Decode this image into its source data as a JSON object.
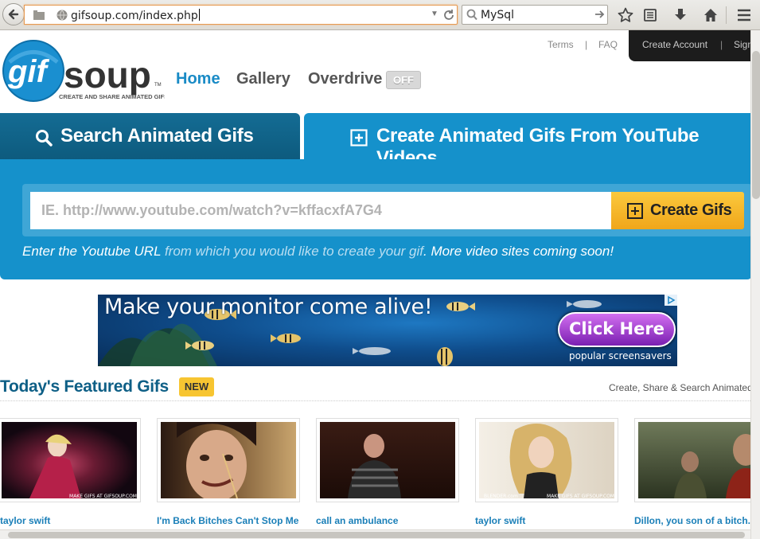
{
  "browser": {
    "url": "gifsoup.com/index.php",
    "search_query": "MySql"
  },
  "header": {
    "logo_text": "gifsoup",
    "logo_tagline": "CREATE AND SHARE ANIMATED GIFS",
    "nav": {
      "home": "Home",
      "gallery": "Gallery",
      "overdrive": "Overdrive",
      "overdrive_state": "OFF"
    },
    "links": {
      "terms": "Terms",
      "faq": "FAQ",
      "create_account": "Create Account",
      "sign_in": "Sign"
    },
    "separator": "|"
  },
  "tabs": {
    "search": "Search Animated Gifs",
    "create": "Create Animated Gifs From YouTube Videos"
  },
  "creator": {
    "input_placeholder": "IE. http://www.youtube.com/watch?v=kffacxfA7G4",
    "button_label": "Create Gifs",
    "helper_part1": "Enter the Youtube URL",
    "helper_part2": " from which you would like to create your gif",
    "helper_part3": ". More video sites coming soon!"
  },
  "ad": {
    "headline": "Make your monitor come alive!",
    "cta": "Click Here",
    "sub": "popular screensavers"
  },
  "featured": {
    "title": "Today's Featured Gifs",
    "badge": "NEW",
    "right_text": "Create, Share & Search Animated",
    "items": [
      {
        "caption": "taylor swift",
        "watermark": "MAKE GIFS AT GIFSOUP.COM"
      },
      {
        "caption": "I'm Back Bitches Can't Stop Me"
      },
      {
        "caption": "call an ambulance"
      },
      {
        "caption": "taylor swift",
        "watermark": "MAKE GIFS AT GIFSOUP.COM",
        "watermark2": "BLENDER.com"
      },
      {
        "caption": "Dillon, you son of a bitch."
      }
    ]
  },
  "colors": {
    "brand_blue": "#1591cb",
    "dark_tab": "#0d5a7d",
    "button_yellow": "#f7c531",
    "nav_active": "#1a8bc6"
  }
}
